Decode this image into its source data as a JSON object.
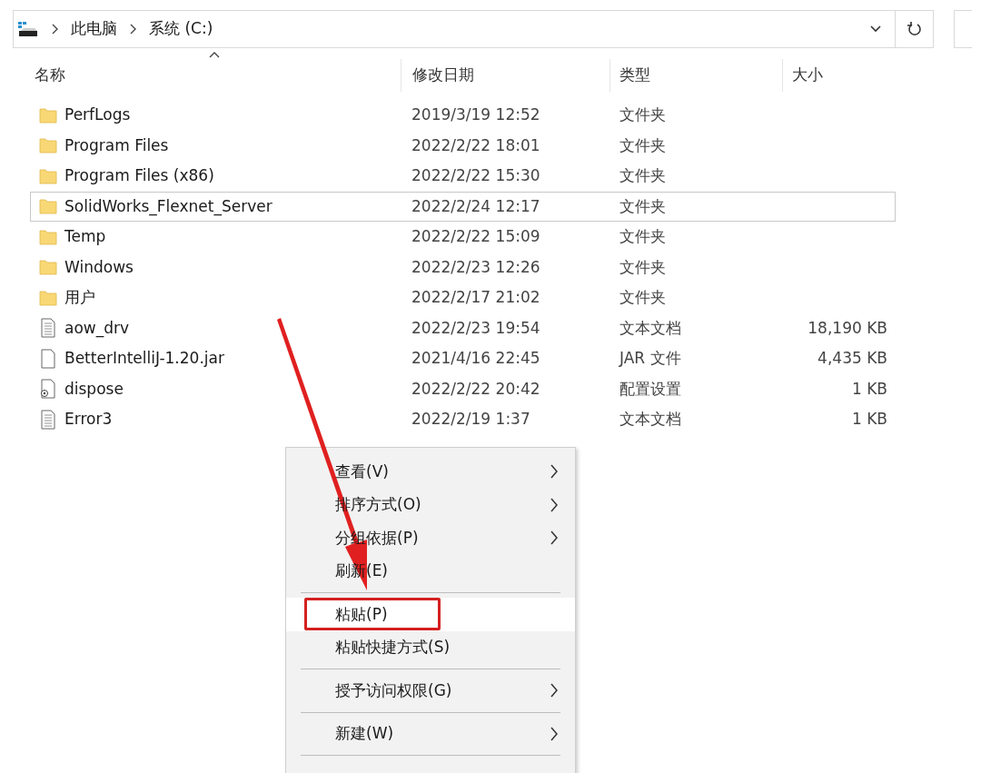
{
  "address_bar": {
    "path": [
      "此电脑",
      "系统 (C:)"
    ]
  },
  "columns": [
    "名称",
    "修改日期",
    "类型",
    "大小"
  ],
  "files": [
    {
      "name": "PerfLogs",
      "date": "2019/3/19 12:52",
      "type": "文件夹",
      "kind": "folder",
      "selected": false
    },
    {
      "name": "Program Files",
      "date": "2022/2/22 18:01",
      "type": "文件夹",
      "kind": "folder",
      "selected": false
    },
    {
      "name": "Program Files (x86)",
      "date": "2022/2/22 15:30",
      "type": "文件夹",
      "kind": "folder",
      "selected": false
    },
    {
      "name": "SolidWorks_Flexnet_Server",
      "date": "2022/2/24 12:17",
      "type": "文件夹",
      "kind": "folder",
      "selected": true
    },
    {
      "name": "Temp",
      "date": "2022/2/22 15:09",
      "type": "文件夹",
      "kind": "folder",
      "selected": false
    },
    {
      "name": "Windows",
      "date": "2022/2/23 12:26",
      "type": "文件夹",
      "kind": "folder",
      "selected": false
    },
    {
      "name": "用户",
      "date": "2022/2/17 21:02",
      "type": "文件夹",
      "kind": "folder",
      "selected": false
    },
    {
      "name": "aow_drv",
      "date": "2022/2/23 19:54",
      "type": "文本文档",
      "size": "18,190 KB",
      "kind": "text",
      "selected": false
    },
    {
      "name": "BetterIntelliJ-1.20.jar",
      "date": "2021/4/16 22:45",
      "type": "JAR 文件",
      "size": "4,435 KB",
      "kind": "blank",
      "selected": false
    },
    {
      "name": "dispose",
      "date": "2022/2/22 20:42",
      "type": "配置设置",
      "size": "1 KB",
      "kind": "config",
      "selected": false
    },
    {
      "name": "Error3",
      "date": "2022/2/19 1:37",
      "type": "文本文档",
      "size": "1 KB",
      "kind": "text",
      "selected": false
    }
  ],
  "context_menu": [
    {
      "label": "查看(V)",
      "submenu": true,
      "selected": false
    },
    {
      "label": "排序方式(O)",
      "submenu": true,
      "selected": false
    },
    {
      "label": "分组依据(P)",
      "submenu": true,
      "selected": false
    },
    {
      "label": "刷新(E)",
      "submenu": false,
      "selected": false,
      "divider_after": true
    },
    {
      "label": "粘贴(P)",
      "submenu": false,
      "selected": true,
      "highlighted": true
    },
    {
      "label": "粘贴快捷方式(S)",
      "submenu": false,
      "selected": false,
      "divider_after": true
    },
    {
      "label": "授予访问权限(G)",
      "submenu": true,
      "selected": false,
      "divider_after": true
    },
    {
      "label": "新建(W)",
      "submenu": true,
      "selected": false,
      "divider_after": true
    }
  ]
}
